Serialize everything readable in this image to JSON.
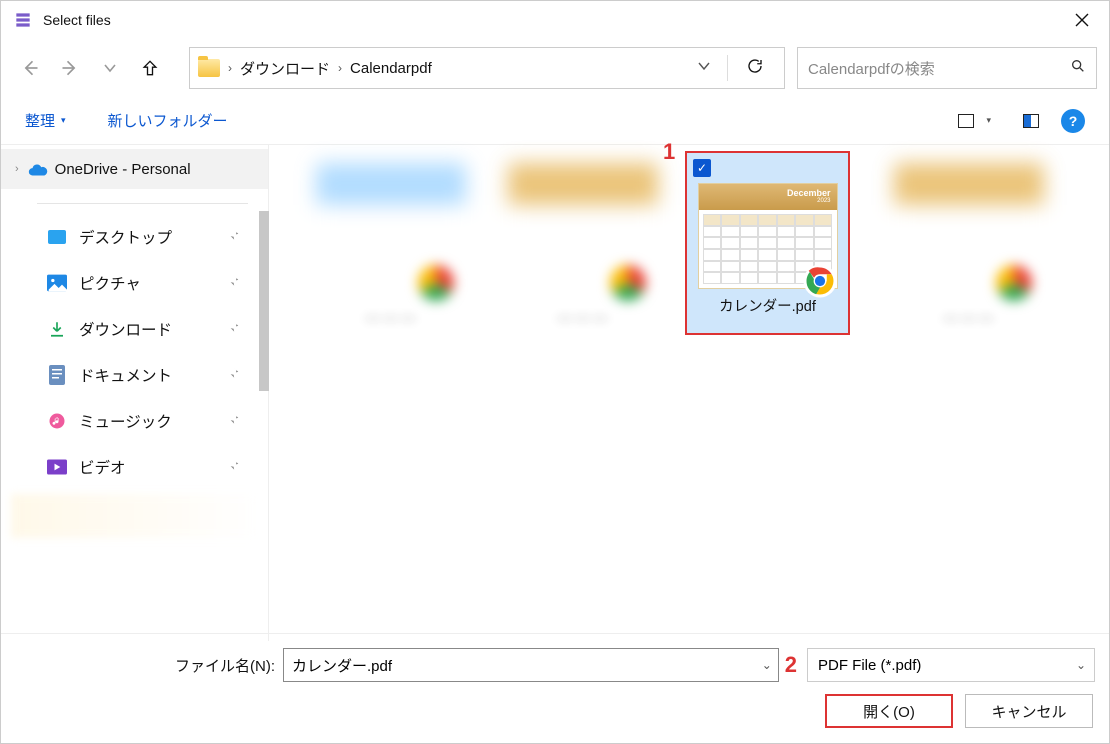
{
  "window": {
    "title": "Select files"
  },
  "breadcrumb": {
    "item1": "ダウンロード",
    "item2": "Calendarpdf"
  },
  "search": {
    "placeholder": "Calendarpdfの検索"
  },
  "toolbar": {
    "organize": "整理",
    "new_folder": "新しいフォルダー"
  },
  "sidebar": {
    "onedrive": "OneDrive - Personal",
    "desktop": "デスクトップ",
    "pictures": "ピクチャ",
    "downloads": "ダウンロード",
    "documents": "ドキュメント",
    "music": "ミュージック",
    "video": "ビデオ"
  },
  "selected_file": {
    "name": "カレンダー.pdf",
    "preview_month": "December",
    "preview_year": "2023"
  },
  "annotations": {
    "one": "1",
    "two": "2"
  },
  "footer": {
    "filename_label": "ファイル名(N):",
    "filename_value": "カレンダー.pdf",
    "filetype": "PDF File (*.pdf)",
    "open": "開く(O)",
    "cancel": "キャンセル"
  }
}
